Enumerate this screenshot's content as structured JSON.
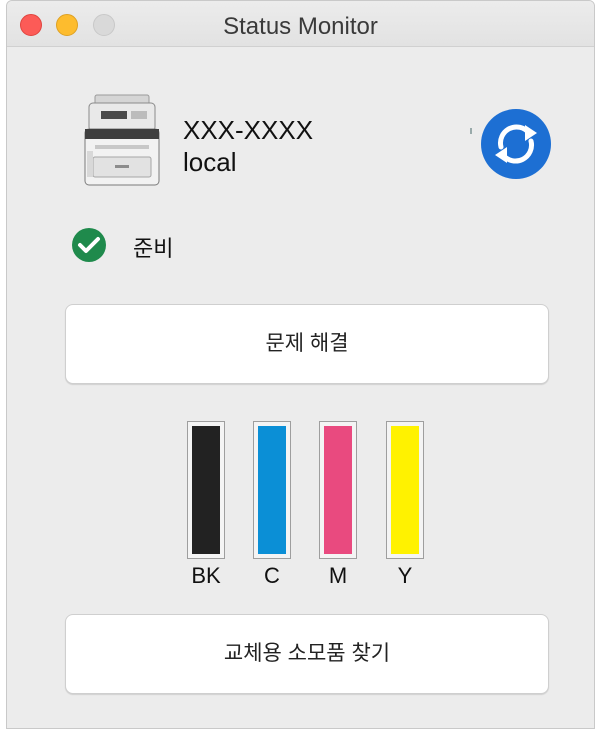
{
  "window": {
    "title": "Status Monitor"
  },
  "device": {
    "name": "XXX-XXXX",
    "location": "local",
    "icon": "printer-icon"
  },
  "refresh": {
    "icon": "refresh-icon",
    "color": "#1d6fd3"
  },
  "status": {
    "text": "준비",
    "icon": "check-circle-icon",
    "color": "#1f8a4c"
  },
  "buttons": {
    "troubleshoot_label": "문제 해결",
    "supplies_label": "교체용 소모품 찾기"
  },
  "ink": [
    {
      "label": "BK",
      "color": "#222222",
      "level": 1.0
    },
    {
      "label": "C",
      "color": "#0b8fd6",
      "level": 1.0
    },
    {
      "label": "M",
      "color": "#e94a7f",
      "level": 1.0
    },
    {
      "label": "Y",
      "color": "#fff200",
      "level": 1.0
    }
  ]
}
